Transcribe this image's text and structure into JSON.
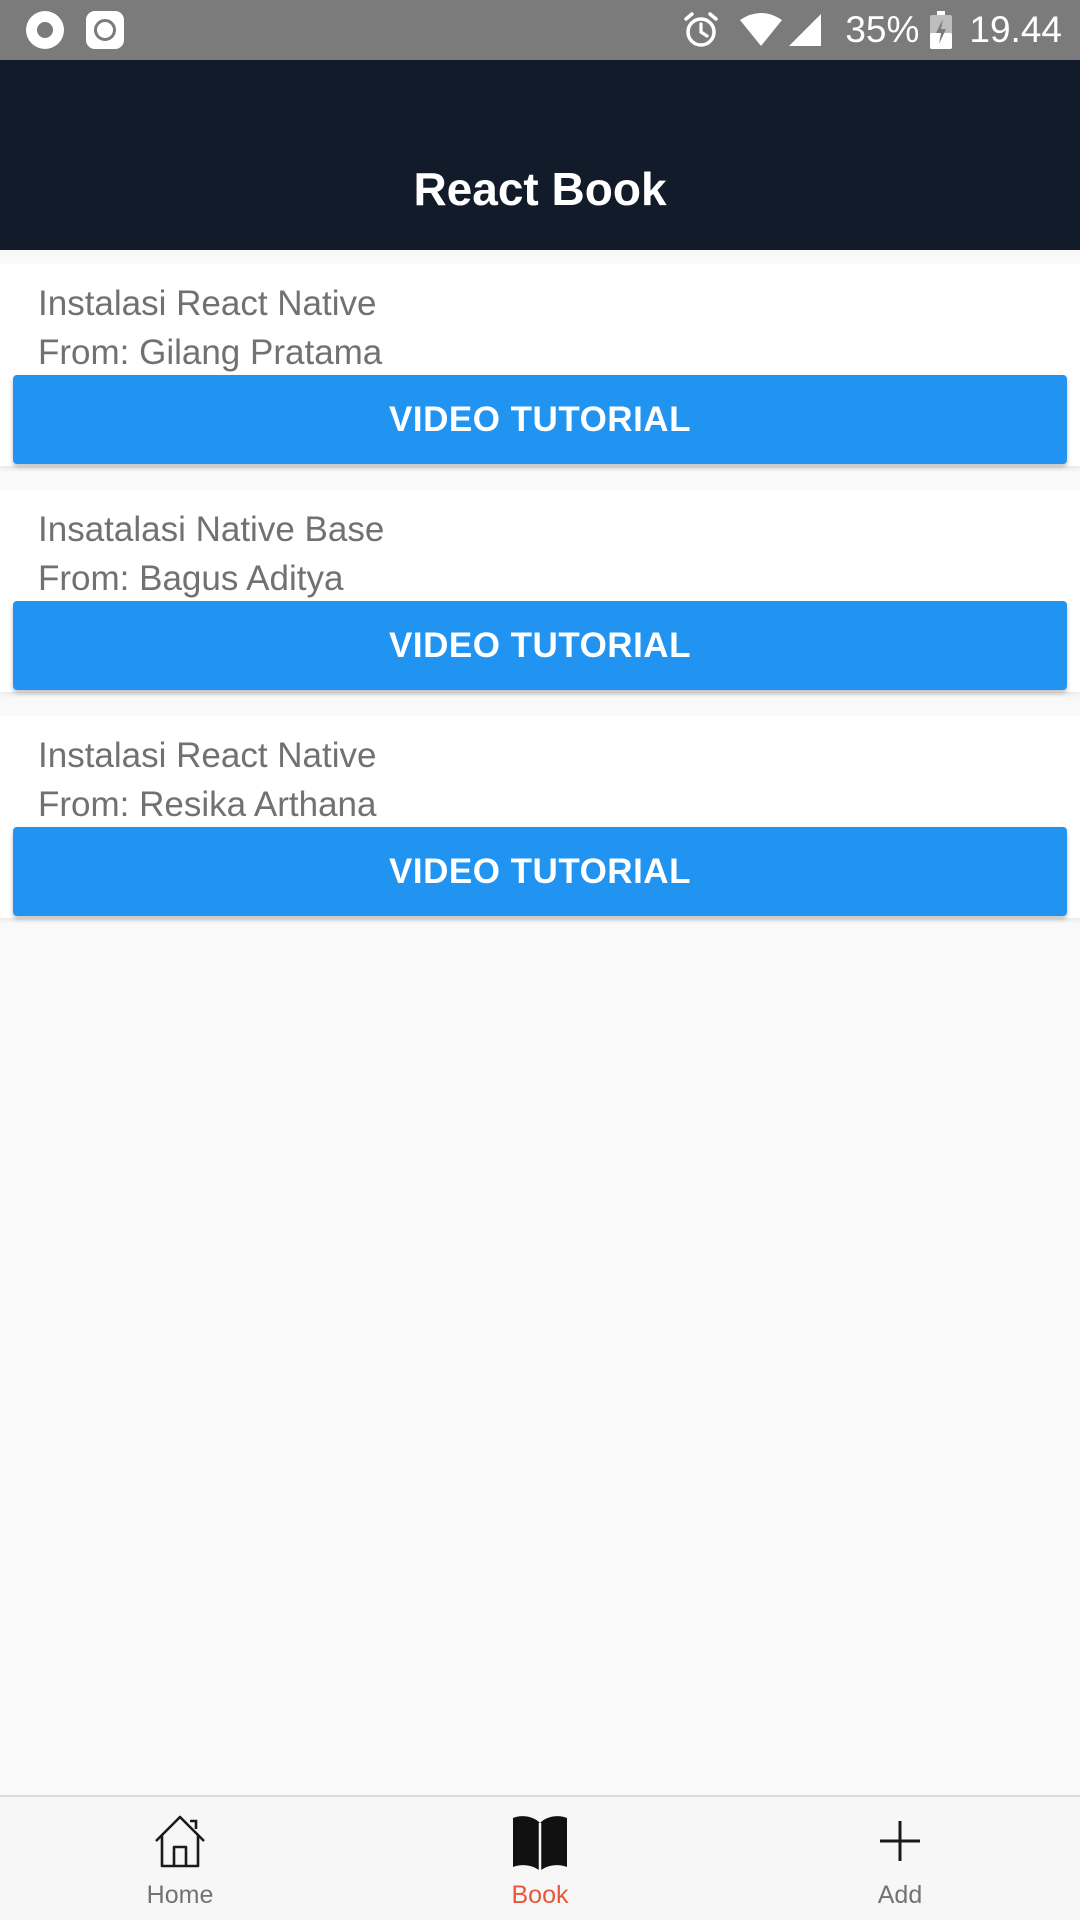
{
  "status_bar": {
    "battery": "35%",
    "time": "19.44",
    "icons": [
      "record-icon",
      "screenshot-icon",
      "alarm-icon",
      "wifi-icon",
      "signal-icon",
      "battery-charging-icon"
    ]
  },
  "header": {
    "title": "React Book",
    "background": "#121b29"
  },
  "books": [
    {
      "title": "Instalasi React Native",
      "author": "From: Gilang Pratama",
      "button_label": "VIDEO TUTORIAL"
    },
    {
      "title": "Insatalasi Native Base",
      "author": "From: Bagus Aditya",
      "button_label": "VIDEO TUTORIAL"
    },
    {
      "title": "Instalasi React Native",
      "author": "From: Resika Arthana",
      "button_label": "VIDEO TUTORIAL"
    }
  ],
  "tabs": [
    {
      "label": "Home",
      "icon": "home-icon",
      "active": false
    },
    {
      "label": "Book",
      "icon": "book-icon",
      "active": true
    },
    {
      "label": "Add",
      "icon": "plus-icon",
      "active": false
    }
  ],
  "colors": {
    "accent_button": "#2194f2",
    "active_tab": "#e8573b",
    "inactive_tab": "#737373"
  }
}
